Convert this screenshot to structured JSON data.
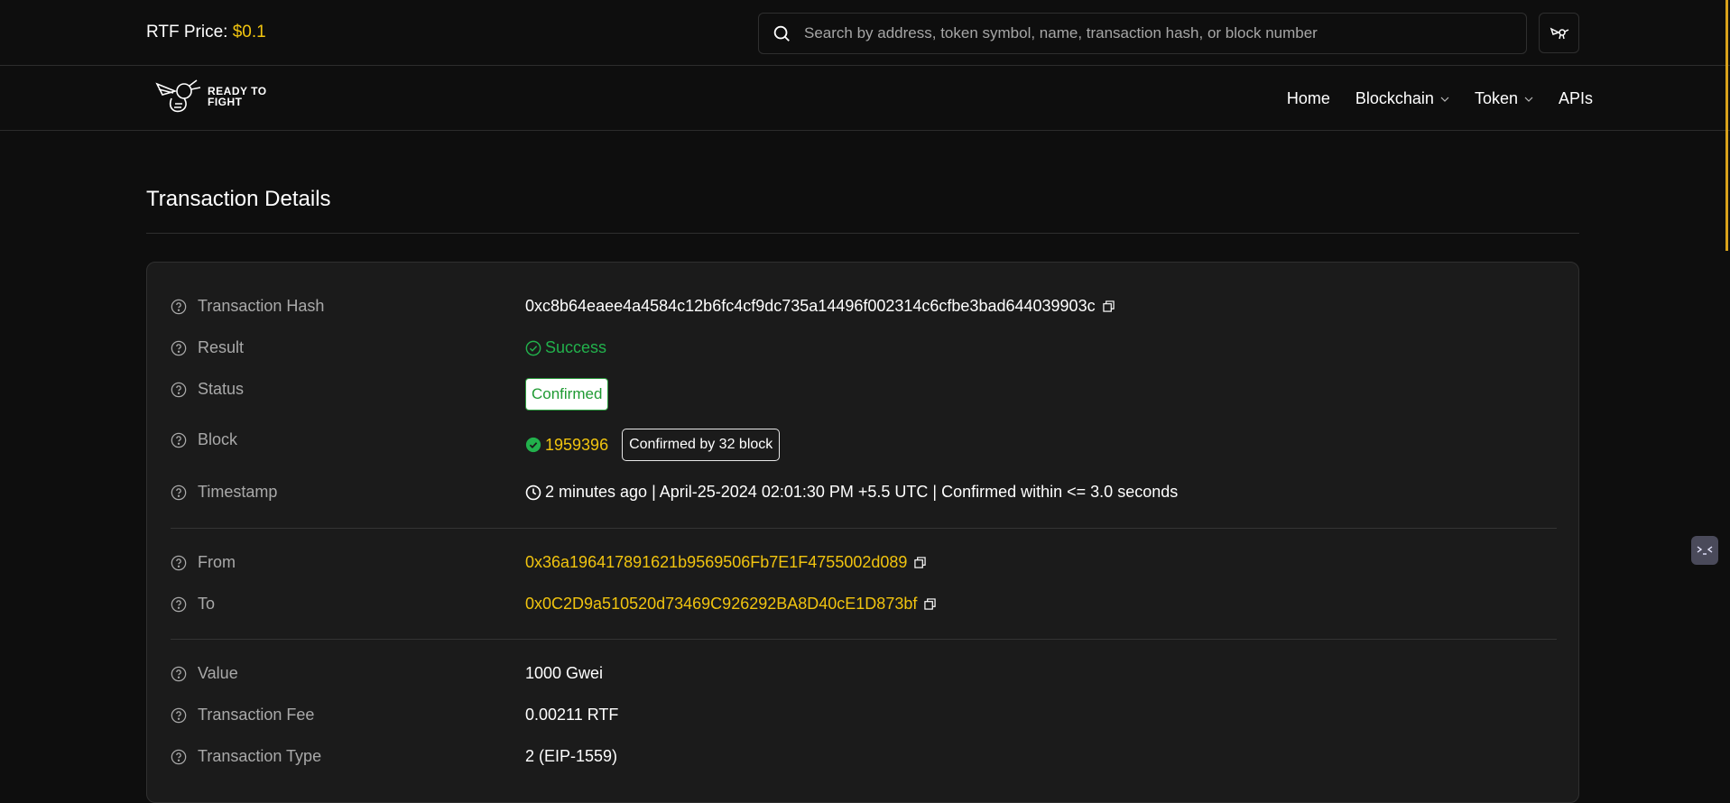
{
  "header": {
    "price_label": "RTF Price:",
    "price_value": "$0.1",
    "search_placeholder": "Search by address, token symbol, name, transaction hash, or block number"
  },
  "brand": {
    "logo_text_line1": "READY TO",
    "logo_text_line2": "FIGHT"
  },
  "nav": {
    "home": "Home",
    "blockchain": "Blockchain",
    "token": "Token",
    "apis": "APIs"
  },
  "page": {
    "title": "Transaction Details"
  },
  "details": {
    "tx_hash_label": "Transaction Hash",
    "tx_hash": "0xc8b64eaee4a4584c12b6fc4cf9dc735a14496f002314c6cfbe3bad644039903c",
    "result_label": "Result",
    "result": "Success",
    "status_label": "Status",
    "status": "Confirmed",
    "block_label": "Block",
    "block": "1959396",
    "block_confirmations": "Confirmed by 32 block",
    "timestamp_label": "Timestamp",
    "timestamp": "2 minutes ago | April-25-2024 02:01:30 PM +5.5 UTC | Confirmed within <= 3.0 seconds",
    "from_label": "From",
    "from": "0x36a196417891621b9569506Fb7E1F4755002d089",
    "to_label": "To",
    "to": "0x0C2D9a510520d73469C926292BA8D40cE1D873bf",
    "value_label": "Value",
    "value": "1000 Gwei",
    "fee_label": "Transaction Fee",
    "fee": "0.00211 RTF",
    "type_label": "Transaction Type",
    "type": "2 (EIP-1559)"
  },
  "colors": {
    "accent": "#f1c40f",
    "success": "#22b14c",
    "background": "#0e0e0e",
    "card": "#1b1b1b"
  }
}
